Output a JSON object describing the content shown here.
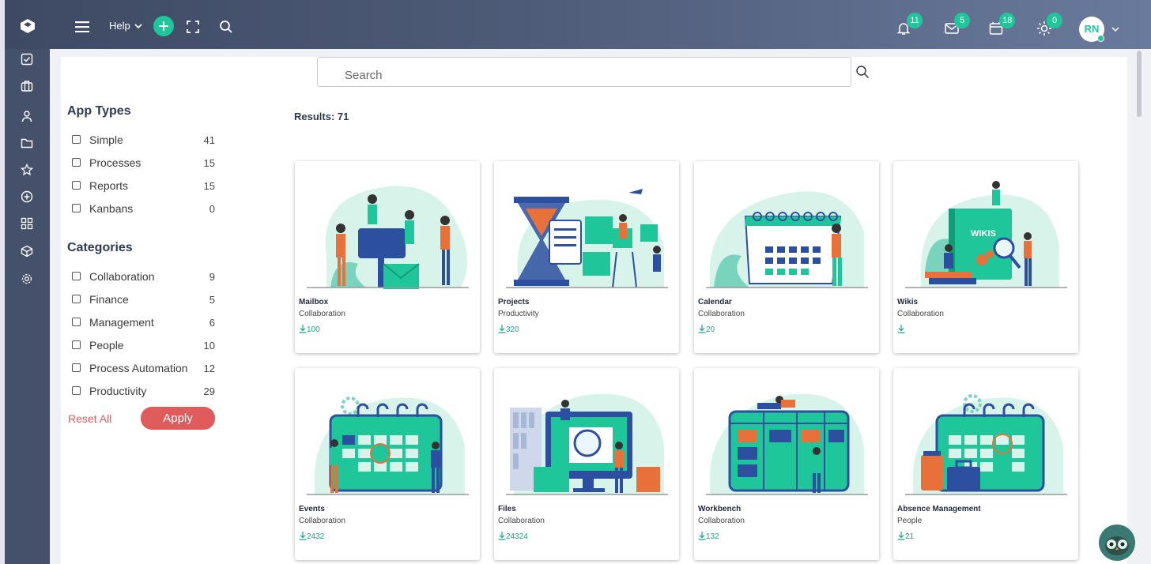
{
  "header": {
    "menu_icon": "hamburger-icon",
    "help_label": "Help",
    "add_icon": "plus-icon",
    "fullscreen_icon": "expand-icon",
    "search_icon": "search-icon",
    "notifications_count": "11",
    "messages_count": "5",
    "calendar_count": "18",
    "activity_count": "0",
    "avatar_initials": "RN",
    "accent_color": "#1fc69a"
  },
  "sidebar": {
    "icons": [
      "tasks-icon",
      "briefcase-icon",
      "user-icon",
      "folder-icon",
      "star-icon",
      "add-circle-icon",
      "apps-grid-icon",
      "box-icon",
      "settings-icon"
    ]
  },
  "search": {
    "placeholder": "Search"
  },
  "filters": {
    "app_types_title": "App Types",
    "app_types": [
      {
        "label": "Simple",
        "count": "41"
      },
      {
        "label": "Processes",
        "count": "15"
      },
      {
        "label": "Reports",
        "count": "15"
      },
      {
        "label": "Kanbans",
        "count": "0"
      }
    ],
    "categories_title": "Categories",
    "categories": [
      {
        "label": "Collaboration",
        "count": "9"
      },
      {
        "label": "Finance",
        "count": "5"
      },
      {
        "label": "Management",
        "count": "6"
      },
      {
        "label": "People",
        "count": "10"
      },
      {
        "label": "Process Automation",
        "count": "12"
      },
      {
        "label": "Productivity",
        "count": "29"
      }
    ],
    "reset_label": "Reset All",
    "apply_label": "Apply"
  },
  "results_label": "Results: 71",
  "apps": [
    {
      "title": "Mailbox",
      "category": "Collaboration",
      "downloads": "100"
    },
    {
      "title": "Projects",
      "category": "Productivity",
      "downloads": "320"
    },
    {
      "title": "Calendar",
      "category": "Collaboration",
      "downloads": "20"
    },
    {
      "title": "Wikis",
      "category": "Collaboration",
      "downloads": ""
    },
    {
      "title": "Events",
      "category": "Collaboration",
      "downloads": "2432"
    },
    {
      "title": "Files",
      "category": "Collaboration",
      "downloads": "24324"
    },
    {
      "title": "Workbench",
      "category": "Collaboration",
      "downloads": "132"
    },
    {
      "title": "Absence Management",
      "category": "People",
      "downloads": "21"
    }
  ],
  "wikis_art_text": "WIKIS"
}
